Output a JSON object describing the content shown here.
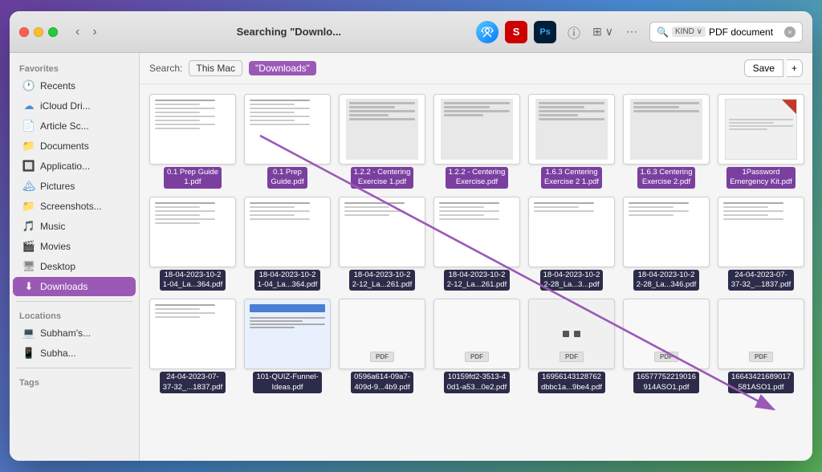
{
  "window": {
    "title": "Searching \"Downlo...",
    "traffic_lights": {
      "red": "close",
      "yellow": "minimize",
      "green": "maximize"
    }
  },
  "toolbar": {
    "nav_back": "‹",
    "nav_forward": "›",
    "airdrop_label": "AirDrop",
    "s_icon_label": "Scrobbles",
    "ps_icon_label": "Photoshop",
    "info_icon_label": "Info",
    "grid_icon_label": "View Options",
    "more_icon_label": "More",
    "search_tag": "KIND ∨",
    "search_value": "PDF document",
    "search_clear": "×"
  },
  "search_bar_row": {
    "search_label": "Search:",
    "this_mac_label": "This Mac",
    "downloads_tag": "\"Downloads\"",
    "save_label": "Save",
    "plus_label": "+"
  },
  "sidebar": {
    "favorites_header": "Favorites",
    "items_favorites": [
      {
        "id": "recents",
        "label": "Recents",
        "icon": "🕐",
        "icon_class": "red"
      },
      {
        "id": "icloud",
        "label": "iCloud Dri...",
        "icon": "☁",
        "icon_class": "blue"
      },
      {
        "id": "article",
        "label": "Article Sc...",
        "icon": "📄",
        "icon_class": "gray"
      },
      {
        "id": "documents",
        "label": "Documents",
        "icon": "📁",
        "icon_class": "gray"
      },
      {
        "id": "applications",
        "label": "Applicatio...",
        "icon": "🔲",
        "icon_class": "gray"
      },
      {
        "id": "pictures",
        "label": "Pictures",
        "icon": "🏔",
        "icon_class": "blue"
      },
      {
        "id": "screenshots",
        "label": "Screenshots...",
        "icon": "📁",
        "icon_class": "blue"
      },
      {
        "id": "music",
        "label": "Music",
        "icon": "🎵",
        "icon_class": "red"
      },
      {
        "id": "movies",
        "label": "Movies",
        "icon": "🎬",
        "icon_class": "gray"
      },
      {
        "id": "desktop",
        "label": "Desktop",
        "icon": "🖥",
        "icon_class": "gray"
      },
      {
        "id": "downloads",
        "label": "Downloads",
        "icon": "⬇",
        "icon_class": "purple",
        "active": true
      }
    ],
    "locations_header": "Locations",
    "items_locations": [
      {
        "id": "subham1",
        "label": "Subham's...",
        "icon": "💻",
        "icon_class": "gray"
      },
      {
        "id": "subham2",
        "label": "Subha...",
        "icon": "📱",
        "icon_class": "gray"
      }
    ],
    "tags_header": "Tags"
  },
  "files": [
    {
      "id": 1,
      "name": "0.1 Prep Guide\n1.pdf",
      "thumb_type": "doc_lines"
    },
    {
      "id": 2,
      "name": "0.1 Prep\nGuide.pdf",
      "thumb_type": "doc_lines"
    },
    {
      "id": 3,
      "name": "1.2.2 - Centering\nExercise 1.pdf",
      "thumb_type": "doc_lines"
    },
    {
      "id": 4,
      "name": "1.2.2 - Centering\nExercise.pdf",
      "thumb_type": "doc_lines"
    },
    {
      "id": 5,
      "name": "1.6.3 Centering\nExercise 2 1.pdf",
      "thumb_type": "doc_lines"
    },
    {
      "id": 6,
      "name": "1.6.3 Centering\nExercise 2.pdf",
      "thumb_type": "doc_lines"
    },
    {
      "id": 7,
      "name": "1Password\nEmergency Kit.pdf",
      "thumb_type": "red_corner"
    },
    {
      "id": 8,
      "name": "18-04-2023-10-2\n1-04_La...364.pdf",
      "thumb_type": "doc_lines"
    },
    {
      "id": 9,
      "name": "18-04-2023-10-2\n1-04_La...364.pdf",
      "thumb_type": "doc_lines"
    },
    {
      "id": 10,
      "name": "18-04-2023-10-2\n2-12_La...261.pdf",
      "thumb_type": "doc_lines"
    },
    {
      "id": 11,
      "name": "18-04-2023-10-2\n2-12_La...261.pdf",
      "thumb_type": "doc_lines"
    },
    {
      "id": 12,
      "name": "18-04-2023-10-2\n2-28_La...3...pdf",
      "thumb_type": "doc_lines"
    },
    {
      "id": 13,
      "name": "18-04-2023-10-2\n2-28_La...346.pdf",
      "thumb_type": "doc_lines"
    },
    {
      "id": 14,
      "name": "24-04-2023-07-\n37-32_...1837.pdf",
      "thumb_type": "doc_lines"
    },
    {
      "id": 15,
      "name": "24-04-2023-07-\n37-32_...1837.pdf",
      "thumb_type": "doc_lines"
    },
    {
      "id": 16,
      "name": "101-QUIZ-Funnel-\nIdeas.pdf",
      "thumb_type": "doc_lines_blue"
    },
    {
      "id": 17,
      "name": "0596a614-09a7-\n409d-9...4b9.pdf",
      "thumb_type": "pdf_plain"
    },
    {
      "id": 18,
      "name": "10159fd2-3513-4\n0d1-a53...0e2.pdf",
      "thumb_type": "pdf_plain"
    },
    {
      "id": 19,
      "name": "16956143128762\ndbbc1a...9be4.pdf",
      "thumb_type": "two_dots"
    },
    {
      "id": 20,
      "name": "16577752219016\n914ASO1.pdf",
      "thumb_type": "pdf_plain"
    },
    {
      "id": 21,
      "name": "16643421689017\n581ASO1.pdf",
      "thumb_type": "pdf_plain"
    }
  ],
  "arrow": {
    "description": "purple diagonal arrow from file 2 to file 21"
  }
}
